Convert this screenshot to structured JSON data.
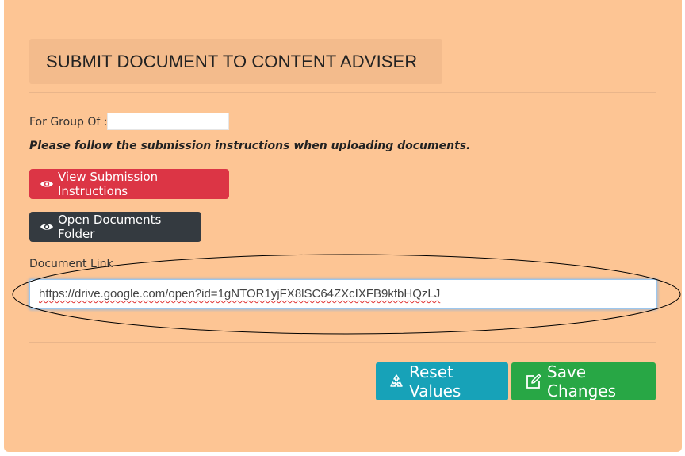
{
  "header": {
    "title": "SUBMIT DOCUMENT TO CONTENT ADVISER"
  },
  "form": {
    "group_label": "For Group Of :",
    "group_value": "",
    "instructions_notice": "Please follow the submission instructions when uploading documents.",
    "view_instructions_label": "View Submission Instructions",
    "open_folder_label": "Open Documents Folder",
    "document_link_label": "Document Link",
    "document_link_value": "https://drive.google.com/open?id=1gNTOR1yjFX8lSC64ZXcIXFB9kfbHQzLJ"
  },
  "actions": {
    "reset_label": "Reset Values",
    "save_label": "Save Changes"
  },
  "icons": {
    "view_instructions": "eye-icon",
    "open_folder": "eye-icon",
    "reset": "recycle-icon",
    "save": "edit-icon"
  },
  "colors": {
    "panel_background": "#fdc594",
    "title_background": "#f3bb8c",
    "danger": "#dc3545",
    "dark": "#343a40",
    "info": "#17a2b8",
    "success": "#28a745",
    "annotation_ellipse": "#000000"
  }
}
